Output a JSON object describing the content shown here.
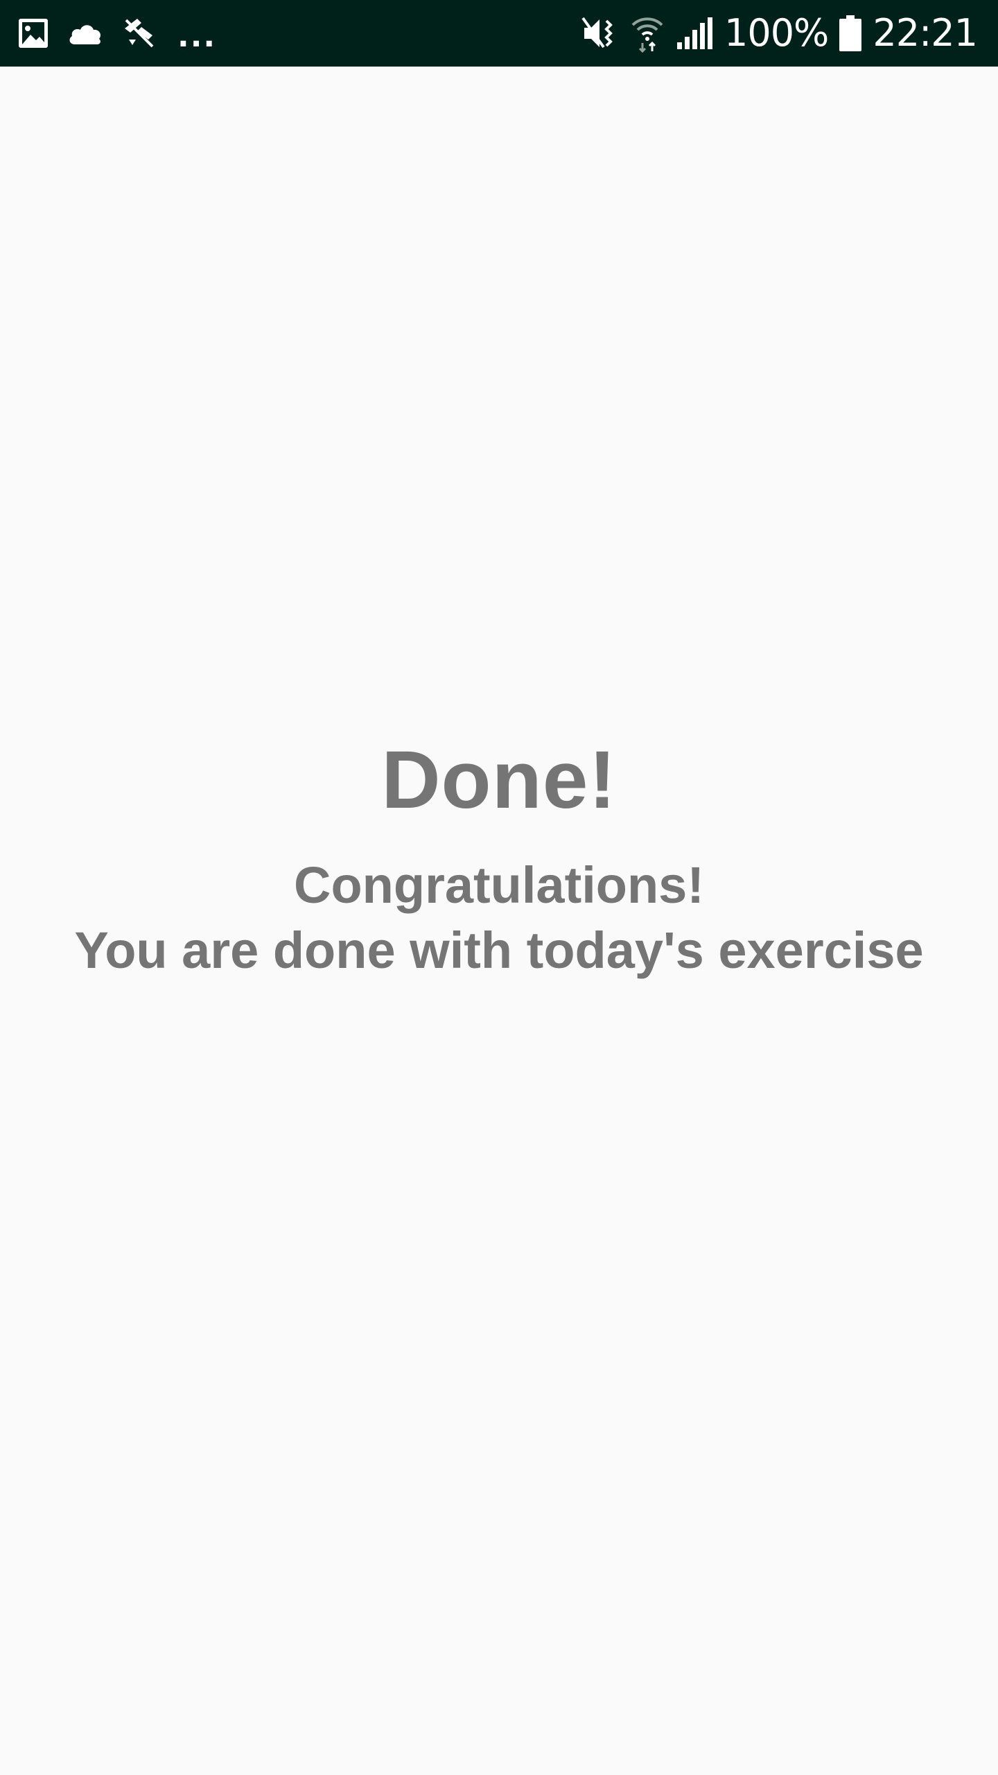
{
  "status_bar": {
    "background": "#00211a",
    "left_icons": [
      "image-icon",
      "cloud-icon",
      "no-location-icon"
    ],
    "overflow_indicator": "...",
    "right_icons": [
      "vibrate-mute-icon",
      "wifi-icon",
      "cell-signal-icon"
    ],
    "battery_percent": "100%",
    "time": "22:21"
  },
  "main": {
    "title": "Done!",
    "message_line1": "Congratulations!",
    "message_line2": "You are done with today's exercise",
    "text_color": "#757575",
    "background": "#fafafa"
  }
}
